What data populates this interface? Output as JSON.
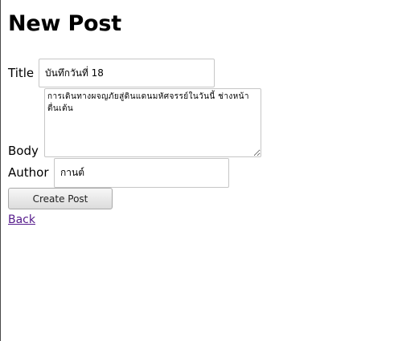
{
  "page": {
    "heading": "New Post"
  },
  "form": {
    "title": {
      "label": "Title",
      "value": "บันทึกวันที่ 18"
    },
    "body": {
      "label": "Body",
      "value": "การเดินทางผจญภัยสู่ดินแดนมหัศจรรย์ในวันนี้ ช่างหน้าตื่นเต้น"
    },
    "author": {
      "label": "Author",
      "value": "กานต์"
    },
    "submit_label": "Create Post"
  },
  "nav": {
    "back_label": "Back"
  }
}
